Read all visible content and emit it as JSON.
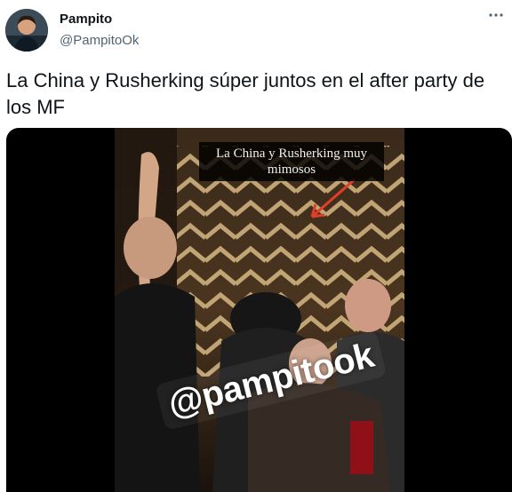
{
  "author": {
    "name": "Pampito",
    "handle": "@PampitoOk",
    "avatar_icon": "user-avatar"
  },
  "more_icon": "more-horizontal-icon",
  "tweet": {
    "text": "La China y Rusherking súper juntos en el after party de los MF"
  },
  "media": {
    "caption": "La China y Rusherking muy mimosos",
    "sticker": "@pampitook",
    "arrow_color": "#e0402a"
  }
}
